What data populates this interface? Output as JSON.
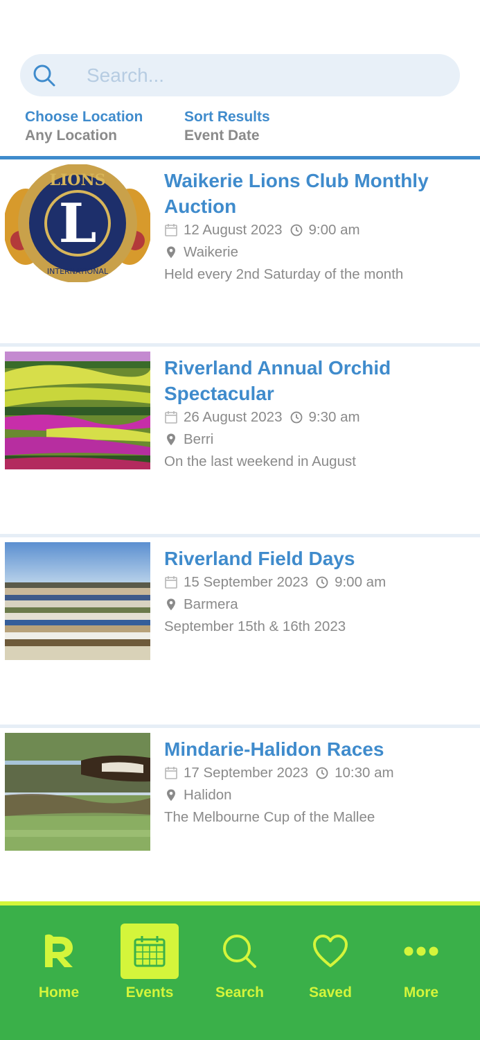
{
  "search": {
    "placeholder": "Search..."
  },
  "filters": {
    "location_label": "Choose Location",
    "location_value": "Any Location",
    "sort_label": "Sort Results",
    "sort_value": "Event Date"
  },
  "events": [
    {
      "title": "Waikerie Lions Club Monthly Auction",
      "date": "12 August 2023",
      "time": "9:00 am",
      "location": "Waikerie",
      "description": "Held every 2nd Saturday of the month"
    },
    {
      "title": "Riverland Annual Orchid Spectacular",
      "date": "26 August 2023",
      "time": "9:30 am",
      "location": "Berri",
      "description": "On the last weekend in August"
    },
    {
      "title": "Riverland Field Days",
      "date": "15 September 2023",
      "time": "9:00 am",
      "location": "Barmera",
      "description": "September 15th & 16th 2023"
    },
    {
      "title": "Mindarie-Halidon Races",
      "date": "17 September 2023",
      "time": "10:30 am",
      "location": "Halidon",
      "description": "The Melbourne Cup of the Mallee"
    }
  ],
  "logo_text": {
    "top": "LIONS",
    "letter": "L",
    "bottom": "INTERNATIONAL"
  },
  "tabs": [
    {
      "label": "Home",
      "icon": "r-logo-icon"
    },
    {
      "label": "Events",
      "icon": "calendar-icon",
      "active": true
    },
    {
      "label": "Search",
      "icon": "search-icon"
    },
    {
      "label": "Saved",
      "icon": "heart-icon"
    },
    {
      "label": "More",
      "icon": "more-dots-icon"
    }
  ],
  "colors": {
    "accent": "#3f8bcc",
    "muted": "#8a8a8a",
    "tabbar": "#3ab049",
    "tab_highlight": "#d4f53b",
    "search_bg": "#e8f0f8"
  }
}
